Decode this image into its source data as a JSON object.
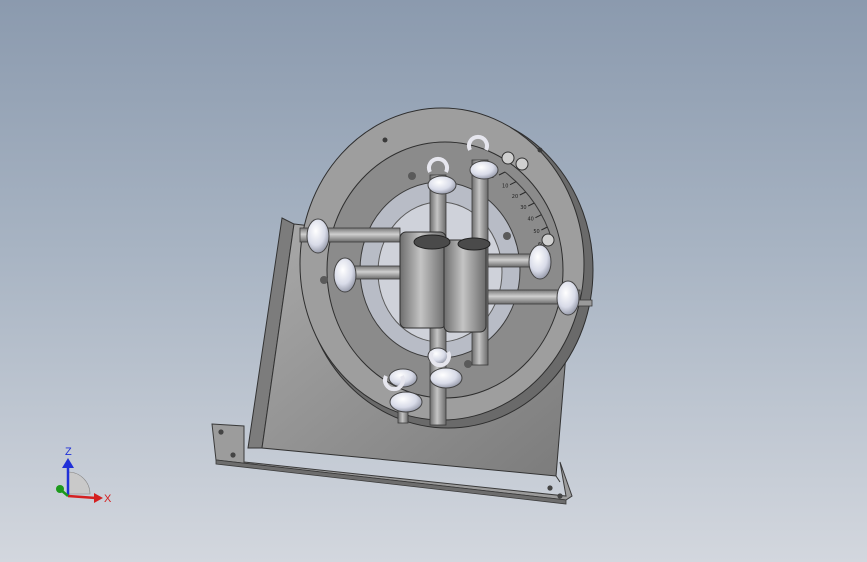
{
  "view": {
    "background_top": "#8b9aae",
    "background_bottom": "#d3d7de"
  },
  "model": {
    "part_color": "#8e8e8e",
    "part_dark": "#5f5f5f",
    "bearing_color": "#d8dbe8",
    "scale_ticks": [
      "0",
      "10",
      "20",
      "30",
      "40",
      "50",
      "60"
    ]
  },
  "triad": {
    "x_label": "X",
    "z_label": "Z",
    "x_color": "#d42020",
    "y_color": "#1c9a1c",
    "z_color": "#2030d8"
  }
}
